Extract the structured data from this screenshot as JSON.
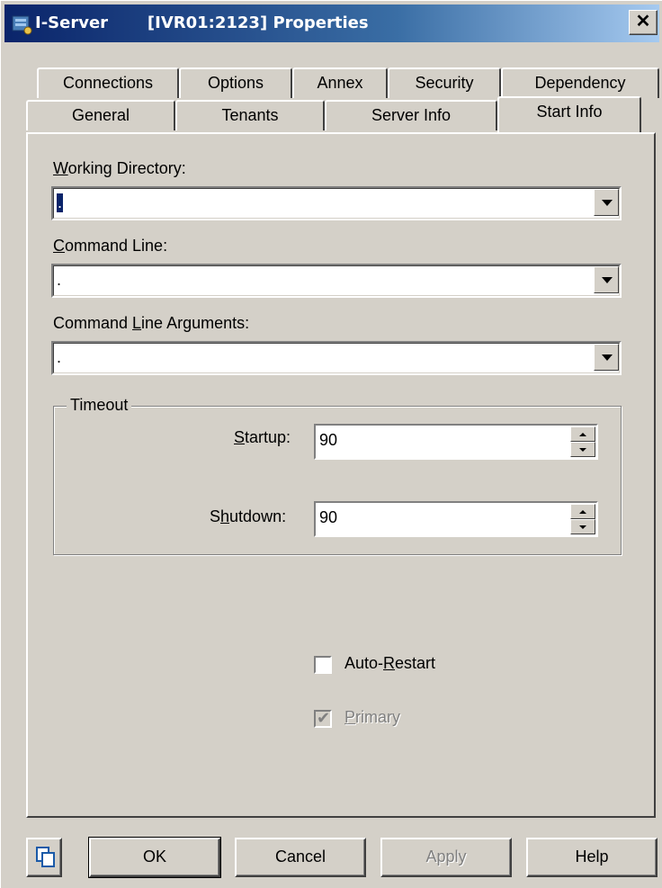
{
  "window": {
    "title": "I-Server       [IVR01:2123] Properties",
    "close_glyph": "✕"
  },
  "tabs": {
    "row1": [
      "Connections",
      "Options",
      "Annex",
      "Security",
      "Dependency"
    ],
    "row2": [
      "General",
      "Tenants",
      "Server Info",
      "Start Info"
    ],
    "active": "Start Info"
  },
  "fields": {
    "working_directory": {
      "label_u": "W",
      "label_rest": "orking Directory:",
      "value": "."
    },
    "command_line": {
      "label_u": "C",
      "label_rest": "ommand Line:",
      "value": "."
    },
    "command_line_args": {
      "label_pre": "Command ",
      "label_u": "L",
      "label_rest": "ine Arguments:",
      "value": "."
    }
  },
  "timeout": {
    "title": "Timeout",
    "startup": {
      "label_u": "S",
      "label_rest": "tartup:",
      "value": "90"
    },
    "shutdown": {
      "label_pre": "S",
      "label_u": "h",
      "label_rest": "utdown:",
      "value": "90"
    }
  },
  "checkboxes": {
    "auto_restart": {
      "label_pre": "Auto-",
      "label_u": "R",
      "label_rest": "estart",
      "checked": false
    },
    "primary": {
      "label_u": "P",
      "label_rest": "rimary",
      "checked": true,
      "disabled": true
    }
  },
  "buttons": {
    "ok": "OK",
    "cancel": "Cancel",
    "apply": "Apply",
    "help": "Help"
  },
  "icons": {
    "title": "server-icon",
    "copy": "copy-icon"
  }
}
